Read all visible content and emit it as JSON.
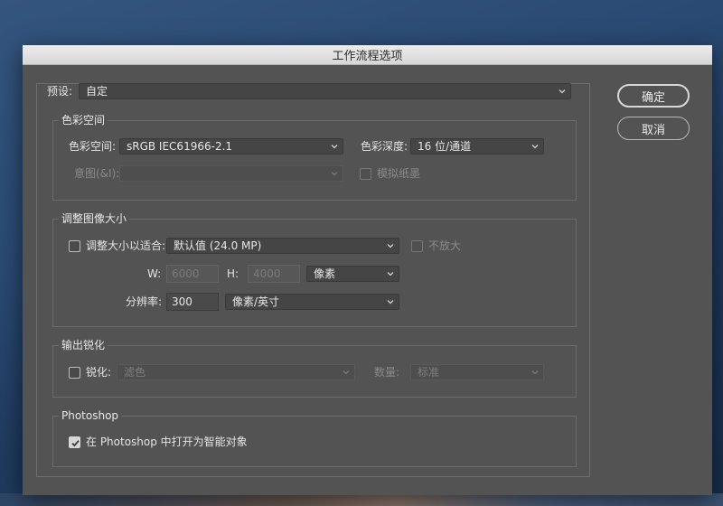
{
  "window": {
    "title": "工作流程选项"
  },
  "preset": {
    "label": "预设:",
    "value": "自定"
  },
  "buttons": {
    "ok": "确定",
    "cancel": "取消"
  },
  "color_space": {
    "title": "色彩空间",
    "space_label": "色彩空间:",
    "space_value": "sRGB IEC61966-2.1",
    "depth_label": "色彩深度:",
    "depth_value": "16 位/通道",
    "intent_label": "意图(&I):",
    "intent_value": "",
    "simulate_paper_label": "模拟纸墨",
    "simulate_paper_checked": false
  },
  "resize": {
    "title": "调整图像大小",
    "fit_label": "调整大小以适合:",
    "fit_checked": false,
    "fit_value": "默认值 (24.0 MP)",
    "no_enlarge_label": "不放大",
    "w_label": "W:",
    "w_value": "6000",
    "h_label": "H:",
    "h_value": "4000",
    "unit_value": "像素",
    "resolution_label": "分辨率:",
    "resolution_value": "300",
    "resolution_unit": "像素/英寸"
  },
  "sharpen": {
    "title": "输出锐化",
    "sharpen_label": "锐化:",
    "sharpen_checked": false,
    "sharpen_for_value": "滤色",
    "amount_label": "数量:",
    "amount_value": "标准"
  },
  "photoshop": {
    "title": "Photoshop",
    "smart_object_label": "在 Photoshop 中打开为智能对象",
    "smart_object_checked": true
  }
}
